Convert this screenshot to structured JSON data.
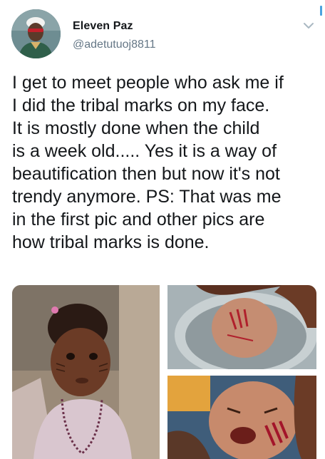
{
  "tweet": {
    "author": {
      "display_name": "Eleven Paz",
      "handle": "@adetutuoj8811",
      "avatar_icon": "profile-photo"
    },
    "menu_icon": "chevron-down-icon",
    "text_lines": [
      "I get to meet people who ask me if",
      "I did the tribal marks on my face.",
      "It is mostly  done when the child",
      "is a week old..... Yes it is a way of",
      "beautification then but now it's not",
      "trendy anymore. PS: That was me",
      "in the first pic and other pics are",
      "how tribal marks is done."
    ],
    "media": [
      {
        "icon": "child-portrait-photo"
      },
      {
        "icon": "infant-head-marks-photo"
      },
      {
        "icon": "crying-infant-photo"
      }
    ]
  },
  "colors": {
    "text": "#14171a",
    "secondary_text": "#657786",
    "background": "#ffffff"
  }
}
